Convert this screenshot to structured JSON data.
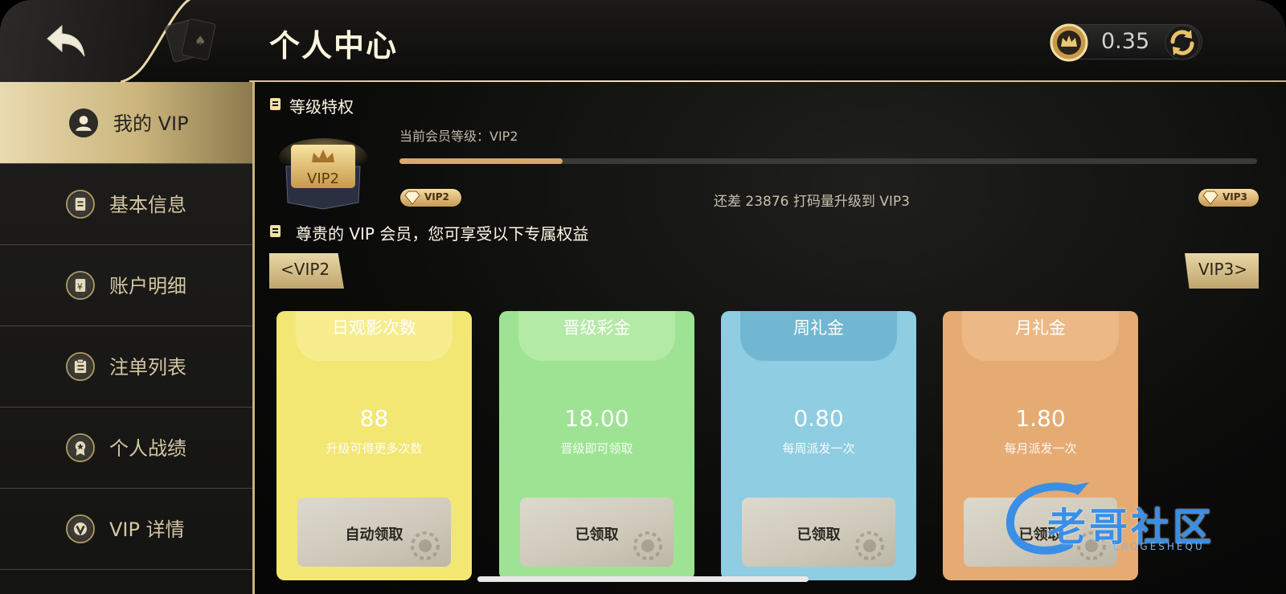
{
  "header": {
    "title": "个人中心",
    "balance": "0.35"
  },
  "sidebar": {
    "items": [
      {
        "label": "我的 VIP",
        "icon": "user-icon",
        "active": true
      },
      {
        "label": "基本信息",
        "icon": "document-icon",
        "active": false
      },
      {
        "label": "账户明细",
        "icon": "yuan-icon",
        "active": false
      },
      {
        "label": "注单列表",
        "icon": "clipboard-icon",
        "active": false
      },
      {
        "label": "个人战绩",
        "icon": "medal-icon",
        "active": false
      },
      {
        "label": "VIP 详情",
        "icon": "vip-v-icon",
        "active": false
      }
    ]
  },
  "level": {
    "section_title": "等级特权",
    "badge": "VIP2",
    "current_label": "当前会员等级：VIP2",
    "progress_fraction": 0.19,
    "from_level": "VIP2",
    "to_level": "VIP3",
    "hint": "还差 23876 打码量升级到 VIP3"
  },
  "benefits": {
    "section_title": "尊贵的 VIP 会员，您可享受以下专属权益",
    "prev_label": "<VIP2",
    "next_label": "VIP3>",
    "cards": [
      {
        "title": "日观影次数",
        "value": "88",
        "desc": "升级可得更多次数",
        "button": "自动领取",
        "color": "#f3e774",
        "tab": "#fff6c0"
      },
      {
        "title": "晋级彩金",
        "value": "18.00",
        "desc": "晋级即可领取",
        "button": "已领取",
        "color": "#9ee393",
        "tab": "#d9f7c8"
      },
      {
        "title": "周礼金",
        "value": "0.80",
        "desc": "每周派发一次",
        "button": "已领取",
        "color": "#8ecde2",
        "tab": "#3f8fb5"
      },
      {
        "title": "月礼金",
        "value": "1.80",
        "desc": "每月派发一次",
        "button": "已领取",
        "color": "#e6ab73",
        "tab": "#f7d3a9"
      }
    ]
  },
  "watermark": {
    "text": "老哥社区",
    "sub": "LAOGESHEQU"
  }
}
